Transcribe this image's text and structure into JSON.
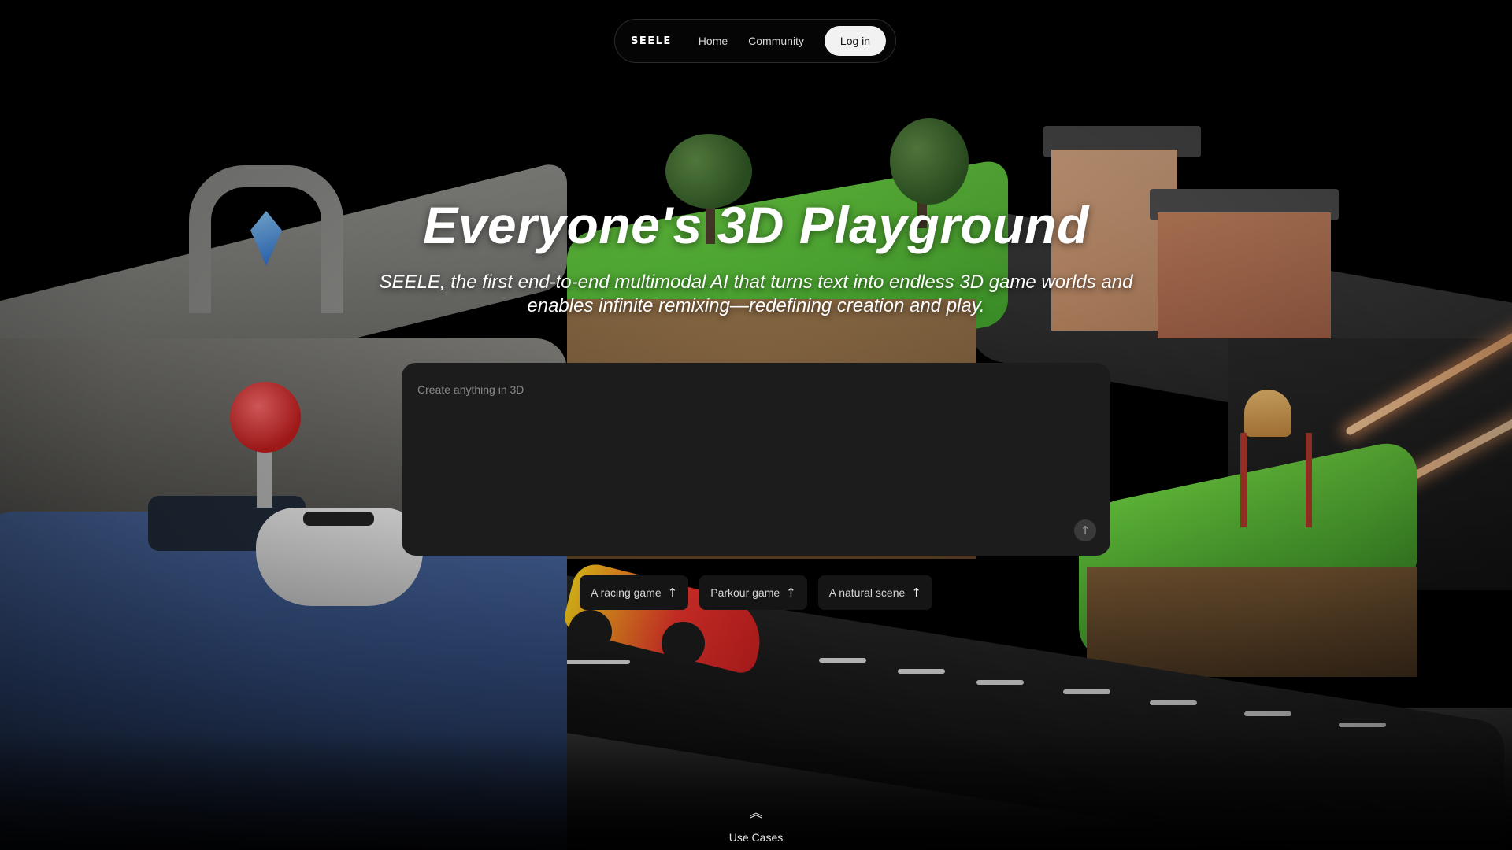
{
  "nav": {
    "logo": "SEELE",
    "links": [
      "Home",
      "Community"
    ],
    "login_label": "Log in"
  },
  "hero": {
    "title": "Everyone's 3D Playground",
    "subtitle": "SEELE, the first end-to-end multimodal AI that turns text into endless 3D game worlds and enables infinite remixing—redefining creation and play."
  },
  "prompt": {
    "placeholder": "Create anything in 3D",
    "value": "",
    "send_icon": "arrow-up-icon"
  },
  "suggestions": [
    {
      "label": "A racing game",
      "icon": "arrow-up-icon"
    },
    {
      "label": "Parkour game",
      "icon": "arrow-up-icon"
    },
    {
      "label": "A natural scene",
      "icon": "arrow-up-icon"
    }
  ],
  "footer": {
    "use_cases_label": "Use Cases",
    "use_cases_icon": "double-chevron-up-icon"
  },
  "colors": {
    "background": "#000000",
    "prompt_bg": "#1c1c1c",
    "chip_bg": "#151515",
    "login_bg": "#f2f2f2"
  }
}
